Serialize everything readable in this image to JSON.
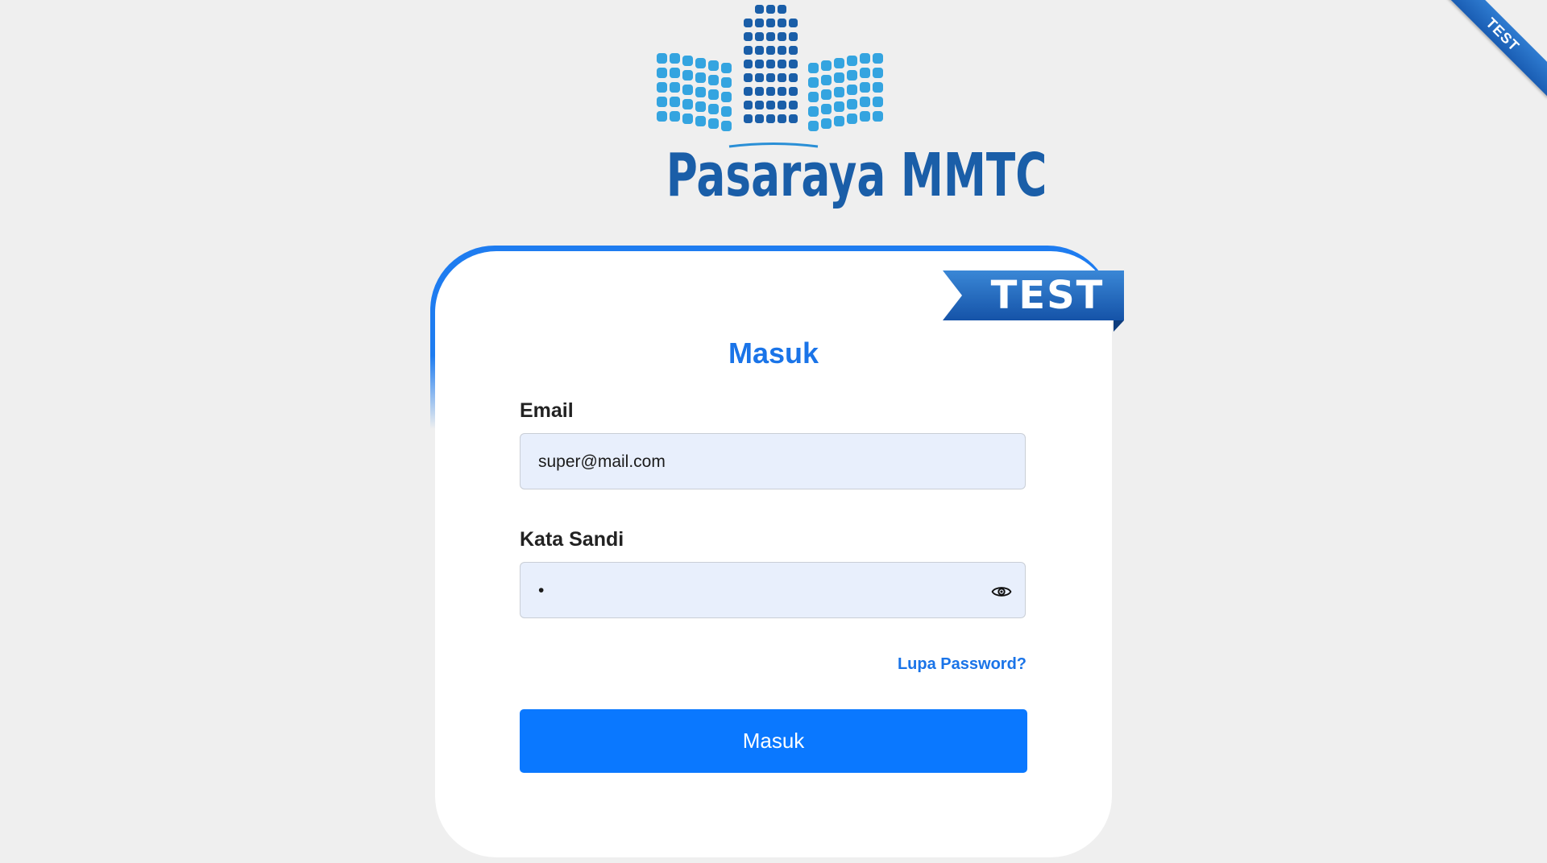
{
  "corner_ribbon": {
    "label": "TEST"
  },
  "brand": {
    "name": "Pasaraya MMTC"
  },
  "card": {
    "badge": "TEST",
    "title": "Masuk"
  },
  "form": {
    "email_label": "Email",
    "email_value": "super@mail.com",
    "password_label": "Kata Sandi",
    "password_value": "•",
    "forgot_link": "Lupa Password?",
    "submit_label": "Masuk"
  },
  "colors": {
    "accent": "#1a74e8",
    "button": "#0a78ff",
    "brand": "#1a5ea8",
    "input_bg": "#e8effc"
  }
}
